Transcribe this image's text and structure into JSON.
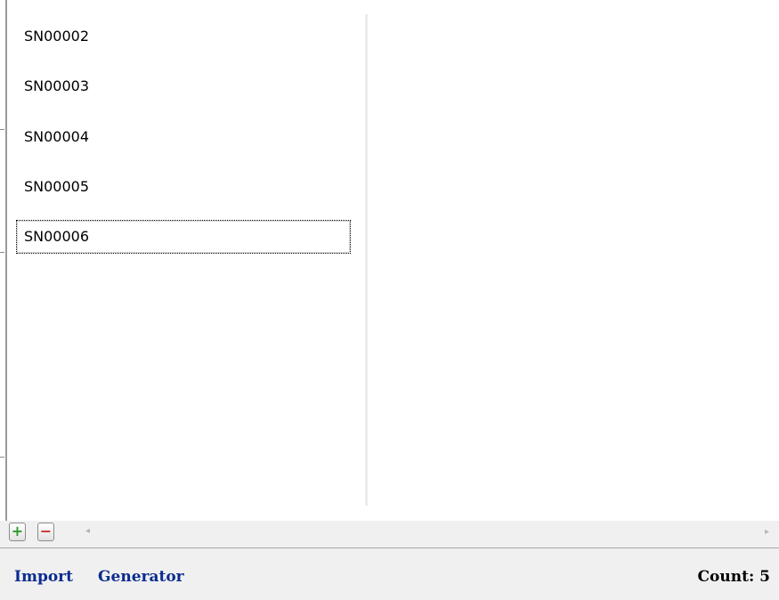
{
  "list": {
    "items": [
      {
        "label": "SN00002",
        "selected": false
      },
      {
        "label": "SN00003",
        "selected": false
      },
      {
        "label": "SN00004",
        "selected": false
      },
      {
        "label": "SN00005",
        "selected": false
      },
      {
        "label": "SN00006",
        "selected": true
      }
    ]
  },
  "toolbar": {
    "add_label": "+",
    "remove_label": "−",
    "scroll_left_glyph": "◂",
    "scroll_right_glyph": "▸"
  },
  "footer": {
    "import_label": "Import",
    "generator_label": "Generator",
    "count_label": "Count: 5"
  },
  "colors": {
    "link": "#0b2c8f",
    "add_icon": "#2e9a2e",
    "remove_icon": "#c83030",
    "panel_bg": "#f0f0f0"
  }
}
